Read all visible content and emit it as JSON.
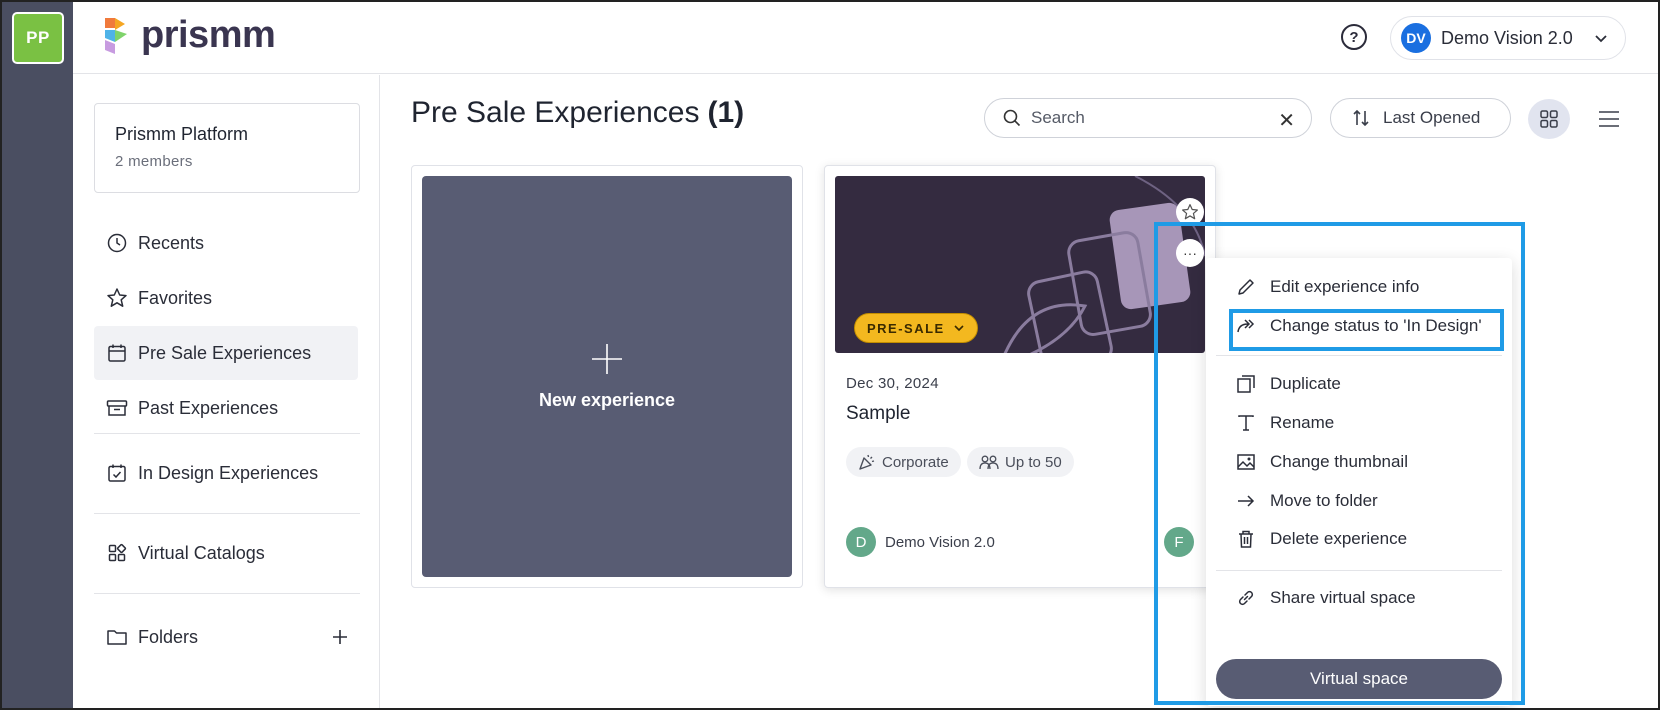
{
  "workspace": {
    "badge": "PP"
  },
  "header": {
    "logo_text": "prismm",
    "help_icon": "question-circle-icon",
    "user": {
      "initials": "DV",
      "name": "Demo Vision 2.0"
    }
  },
  "sidebar": {
    "org": {
      "name": "Prismm Platform",
      "members": "2 members"
    },
    "items": [
      {
        "label": "Recents",
        "icon": "clock-icon"
      },
      {
        "label": "Favorites",
        "icon": "star-icon"
      },
      {
        "label": "Pre Sale Experiences",
        "icon": "calendar-icon",
        "active": true
      },
      {
        "label": "Past Experiences",
        "icon": "archive-icon"
      },
      {
        "label": "In Design Experiences",
        "icon": "calendar-check-icon"
      },
      {
        "label": "Virtual Catalogs",
        "icon": "grid-icon"
      },
      {
        "label": "Folders",
        "icon": "folder-icon"
      }
    ]
  },
  "main": {
    "title": "Pre Sale Experiences",
    "count": "(1)",
    "search": {
      "placeholder": "Search",
      "value": ""
    },
    "sort_label": "Last Opened",
    "new_experience_label": "New experience",
    "card": {
      "status": "PRE-SALE",
      "date": "Dec 30, 2024",
      "name": "Sample",
      "tags": [
        "Corporate",
        "Up to 50"
      ],
      "owner_initial": "D",
      "owner_name": "Demo Vision 2.0",
      "assignee_initial": "F"
    }
  },
  "context_menu": {
    "items": [
      {
        "label": "Edit experience info",
        "icon": "pencil-icon"
      },
      {
        "label": "Change status to 'In Design'",
        "icon": "forward-arrow-icon"
      },
      {
        "label": "Duplicate",
        "icon": "duplicate-icon"
      },
      {
        "label": "Rename",
        "icon": "text-icon"
      },
      {
        "label": "Change thumbnail",
        "icon": "image-icon"
      },
      {
        "label": "Move to folder",
        "icon": "arrow-right-icon"
      },
      {
        "label": "Delete experience",
        "icon": "trash-icon"
      },
      {
        "label": "Share virtual space",
        "icon": "link-icon"
      }
    ],
    "primary_button": "Virtual space"
  },
  "colors": {
    "rail": "#4a4e61",
    "workspace_badge": "#7ac143",
    "accent": "#585c73",
    "status_pill": "#f3b81f",
    "highlight": "#1f9be6",
    "avatar_blue": "#1a6fe0",
    "avatar_green": "#63a88a"
  }
}
